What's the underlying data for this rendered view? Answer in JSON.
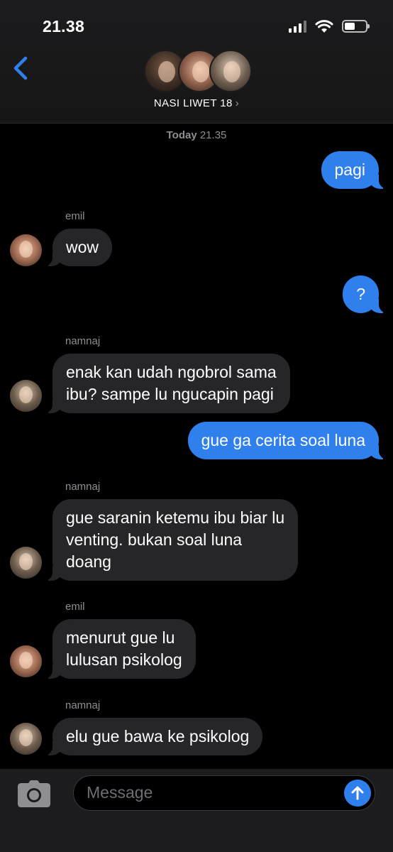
{
  "status_bar": {
    "time": "21.38"
  },
  "header": {
    "group_name": "NASI LIWET 18",
    "chevron": "›"
  },
  "thread": {
    "timestamp_day": "Today",
    "timestamp_time": "21.35",
    "messages": [
      {
        "direction": "outgoing",
        "text": "pagi"
      },
      {
        "direction": "incoming",
        "sender": "emil",
        "text": "wow"
      },
      {
        "direction": "outgoing",
        "text": "?"
      },
      {
        "direction": "incoming",
        "sender": "namnaj",
        "lines": [
          "enak kan udah ngobrol sama",
          "ibu? sampe lu ngucapin pagi"
        ]
      },
      {
        "direction": "outgoing",
        "text": "gue ga cerita soal luna"
      },
      {
        "direction": "incoming",
        "sender": "namnaj",
        "lines": [
          "gue saranin ketemu ibu biar lu",
          "venting. bukan soal luna",
          "doang"
        ]
      },
      {
        "direction": "incoming",
        "sender": "emil",
        "lines": [
          "menurut gue lu",
          "lulusan psikolog"
        ]
      },
      {
        "direction": "incoming",
        "sender": "namnaj",
        "text": "elu gue bawa ke psikolog"
      }
    ]
  },
  "composer": {
    "placeholder": "Message"
  },
  "colors": {
    "outgoing_bubble": "#2f80ed",
    "incoming_bubble": "#262628",
    "accent": "#2f80ed",
    "background": "#000000"
  },
  "icons": [
    "back-chevron-icon",
    "camera-icon",
    "send-arrow-icon",
    "signal-icon",
    "wifi-icon",
    "battery-icon"
  ]
}
